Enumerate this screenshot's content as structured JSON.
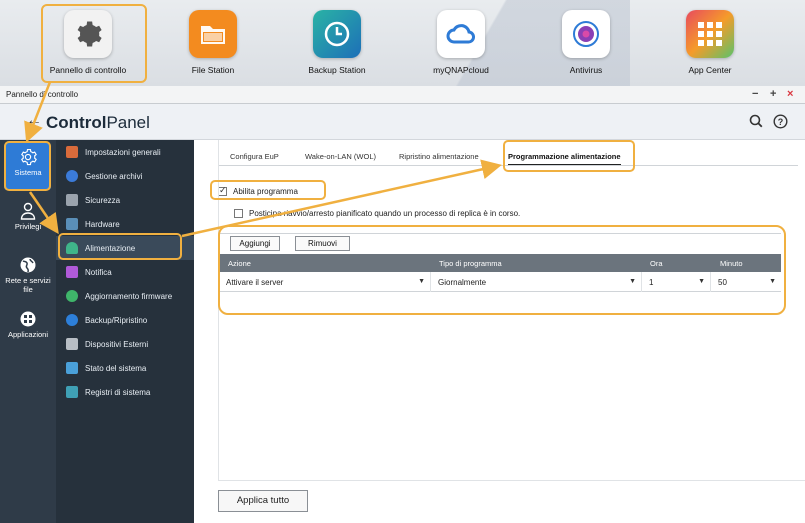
{
  "desktop": {
    "apps": [
      {
        "label": "Pannello di controllo",
        "icon": "gear-icon"
      },
      {
        "label": "File Station",
        "icon": "folder-icon"
      },
      {
        "label": "Backup Station",
        "icon": "clock-icon"
      },
      {
        "label": "myQNAPcloud",
        "icon": "cloud-icon"
      },
      {
        "label": "Antivirus",
        "icon": "antivirus-icon"
      },
      {
        "label": "App Center",
        "icon": "app-grid-icon"
      }
    ]
  },
  "window": {
    "title": "Pannello di controllo",
    "controls": {
      "minimize": "−",
      "maximize": "+",
      "close": "×"
    }
  },
  "header": {
    "back": "←",
    "brand_bold": "Control",
    "brand_light": "Panel"
  },
  "rail": {
    "items": [
      {
        "label": "Sistema",
        "icon": "gear-icon"
      },
      {
        "label": "Privilegi",
        "icon": "user-icon"
      },
      {
        "label": "Rete e servizi file",
        "icon": "globe-icon"
      },
      {
        "label": "Applicazioni",
        "icon": "apps-icon"
      }
    ]
  },
  "submenu": {
    "items": [
      {
        "label": "Impostazioni generali",
        "color": "#d96b3b"
      },
      {
        "label": "Gestione archivi",
        "color": "#3b7bd9"
      },
      {
        "label": "Sicurezza",
        "color": "#9aa3ad"
      },
      {
        "label": "Hardware",
        "color": "#5a8fb8"
      },
      {
        "label": "Alimentazione",
        "color": "#3fb58a"
      },
      {
        "label": "Notifica",
        "color": "#b05ad9"
      },
      {
        "label": "Aggiornamento firmware",
        "color": "#3fb56a"
      },
      {
        "label": "Backup/Ripristino",
        "color": "#2d7fd9"
      },
      {
        "label": "Dispositivi Esterni",
        "color": "#b8bec5"
      },
      {
        "label": "Stato del sistema",
        "color": "#4aa0d9"
      },
      {
        "label": "Registri di sistema",
        "color": "#3fa0b5"
      }
    ]
  },
  "tabs": [
    {
      "label": "Configura EuP"
    },
    {
      "label": "Wake-on-LAN (WOL)"
    },
    {
      "label": "Ripristino alimentazione"
    },
    {
      "label": "Programmazione alimentazione"
    }
  ],
  "schedule": {
    "enable_label": "Abilita programma",
    "enable_checked": true,
    "postpone_label": "Posticipa riavvio/arresto pianificato quando un processo di replica è in corso.",
    "postpone_checked": false,
    "add_button": "Aggiungi",
    "remove_button": "Rimuovi",
    "columns": [
      "Azione",
      "Tipo di programma",
      "Ora",
      "Minuto"
    ],
    "rows": [
      {
        "azione": "Attivare il server",
        "tipo": "Giornalmente",
        "ora": "1",
        "minuto": "50"
      }
    ],
    "dropdown_arrow": "▼"
  },
  "footer": {
    "apply_all": "Applica tutto"
  },
  "colors": {
    "accent": "#2e7bd6",
    "callout": "#f0b040",
    "rail_bg": "#2f3b48",
    "submenu_bg": "#26313c"
  }
}
